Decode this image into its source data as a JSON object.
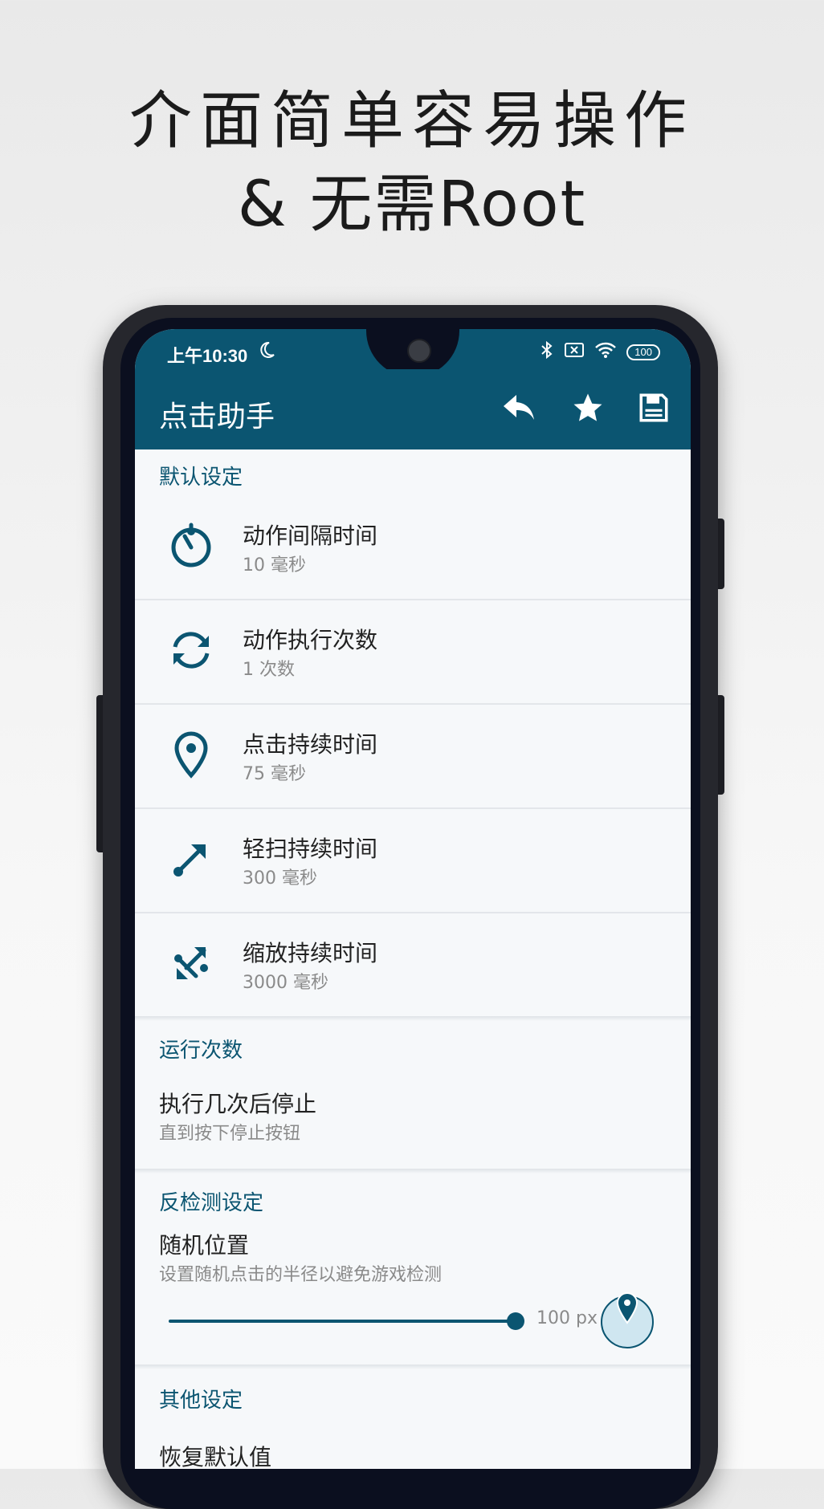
{
  "promo": {
    "line1": "介面简单容易操作",
    "line2": "& 无需Root"
  },
  "status_bar": {
    "time": "上午10:30",
    "battery": "100",
    "icons": [
      "moon-icon",
      "bluetooth-icon",
      "sim-off-icon",
      "wifi-icon",
      "battery-icon"
    ]
  },
  "app_bar": {
    "title": "点击助手",
    "actions": [
      "undo-icon",
      "star-icon",
      "save-icon"
    ]
  },
  "sections": {
    "defaults": {
      "title": "默认设定",
      "items": [
        {
          "title": "动作间隔时间",
          "value": "10 毫秒",
          "icon": "timer-icon"
        },
        {
          "title": "动作执行次数",
          "value": "1 次数",
          "icon": "repeat-icon"
        },
        {
          "title": "点击持续时间",
          "value": "75 毫秒",
          "icon": "location-pin-icon"
        },
        {
          "title": "轻扫持续时间",
          "value": "300 毫秒",
          "icon": "swipe-arrow-icon"
        },
        {
          "title": "缩放持续时间",
          "value": "3000 毫秒",
          "icon": "zoom-arrows-icon"
        }
      ]
    },
    "run_count": {
      "title": "运行次数",
      "item_title": "执行几次后停止",
      "item_value": "直到按下停止按钮"
    },
    "anti_detect": {
      "title": "反检测设定",
      "item_title": "随机位置",
      "item_desc": "设置随机点击的半径以避免游戏检测",
      "slider_value": "100 px",
      "slider_fraction": 1.0
    },
    "other": {
      "title": "其他设定",
      "item_title": "恢复默认值"
    }
  },
  "colors": {
    "primary": "#0b5571",
    "screen_bg": "#f6f8fa"
  }
}
